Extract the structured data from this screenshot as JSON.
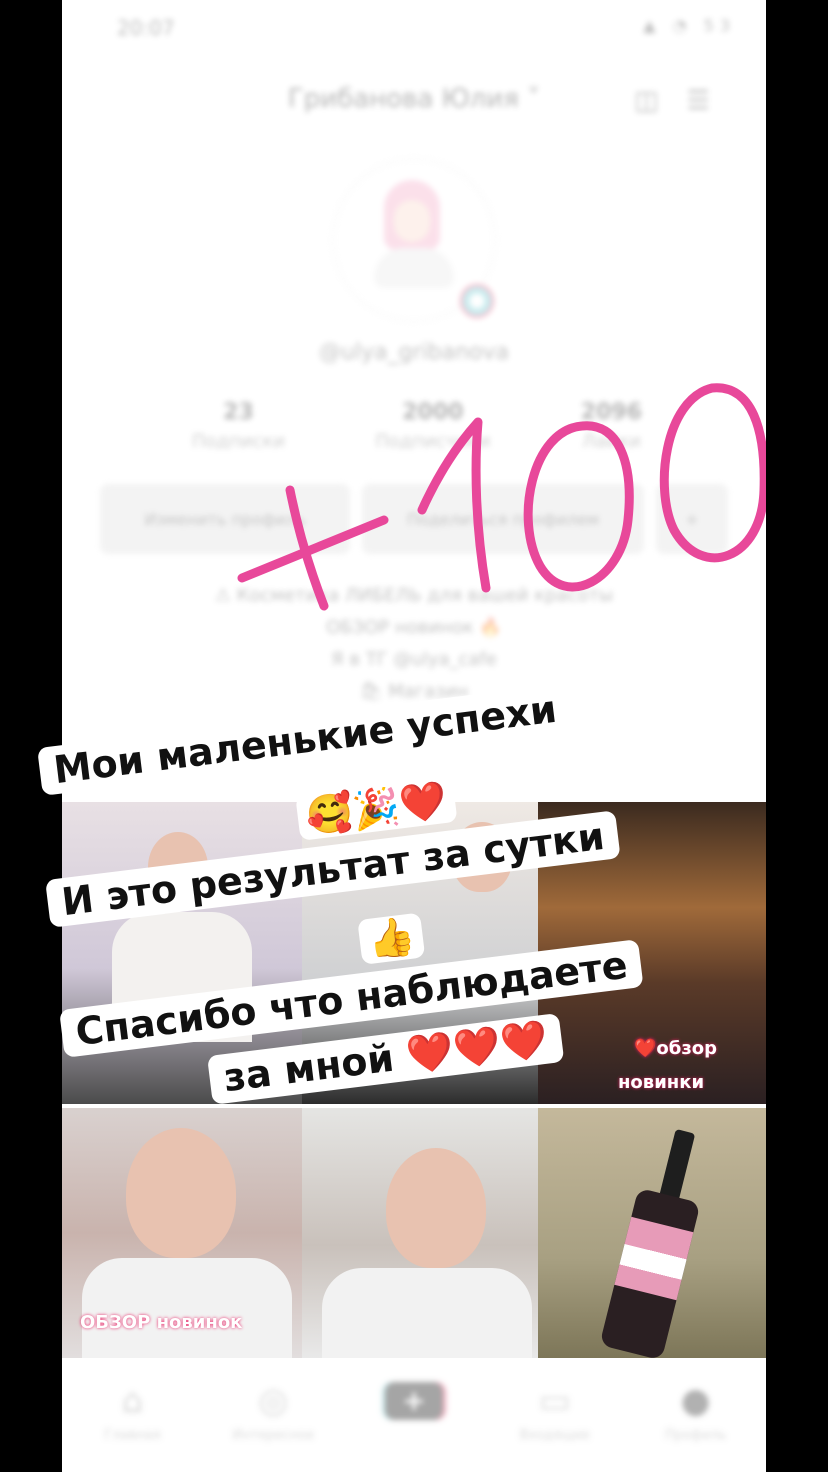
{
  "status_bar": {
    "time": "20:07",
    "icons": "▲ ◔ 53"
  },
  "profile": {
    "name": "Грибанова Юлия ˅",
    "username": "@ulya_gribanova",
    "stats": [
      {
        "value": "23",
        "label": "Подписки"
      },
      {
        "value": "2000",
        "label": "Подписчики"
      },
      {
        "value": "2096",
        "label": "Лайки"
      }
    ],
    "buttons": [
      "Изменить профиль",
      "Поделиться профилем",
      "+"
    ],
    "bio_lines": [
      "⚠ Косметика ЛИБЕЛЬ для вашей красоты",
      "ОБЗОР новинок 🔥",
      "Я в ТГ @ulya_cafe"
    ],
    "bio_link": "🛍 Магазин"
  },
  "handwriting": {
    "text": "+100",
    "color": "#e8489a"
  },
  "captions": {
    "line1": "Мои маленькие успехи",
    "emoji1": "🥰🎉❤️",
    "line2": "И это результат за сутки",
    "emoji2": "👍",
    "line3a": "Спасибо что наблюдаете",
    "line3b": "за мной ❤️❤️❤️"
  },
  "grid_overlays": {
    "chip1": "❤️обзор",
    "chip2": "новинки",
    "chip3": "ОБЗОР новинок"
  },
  "bottom_nav": [
    {
      "icon": "home-icon",
      "label": "Главная"
    },
    {
      "icon": "compass-icon",
      "label": "Интересное"
    },
    {
      "icon": "plus-icon",
      "label": ""
    },
    {
      "icon": "inbox-icon",
      "label": "Входящие"
    },
    {
      "icon": "profile-icon",
      "label": "Профиль"
    }
  ]
}
